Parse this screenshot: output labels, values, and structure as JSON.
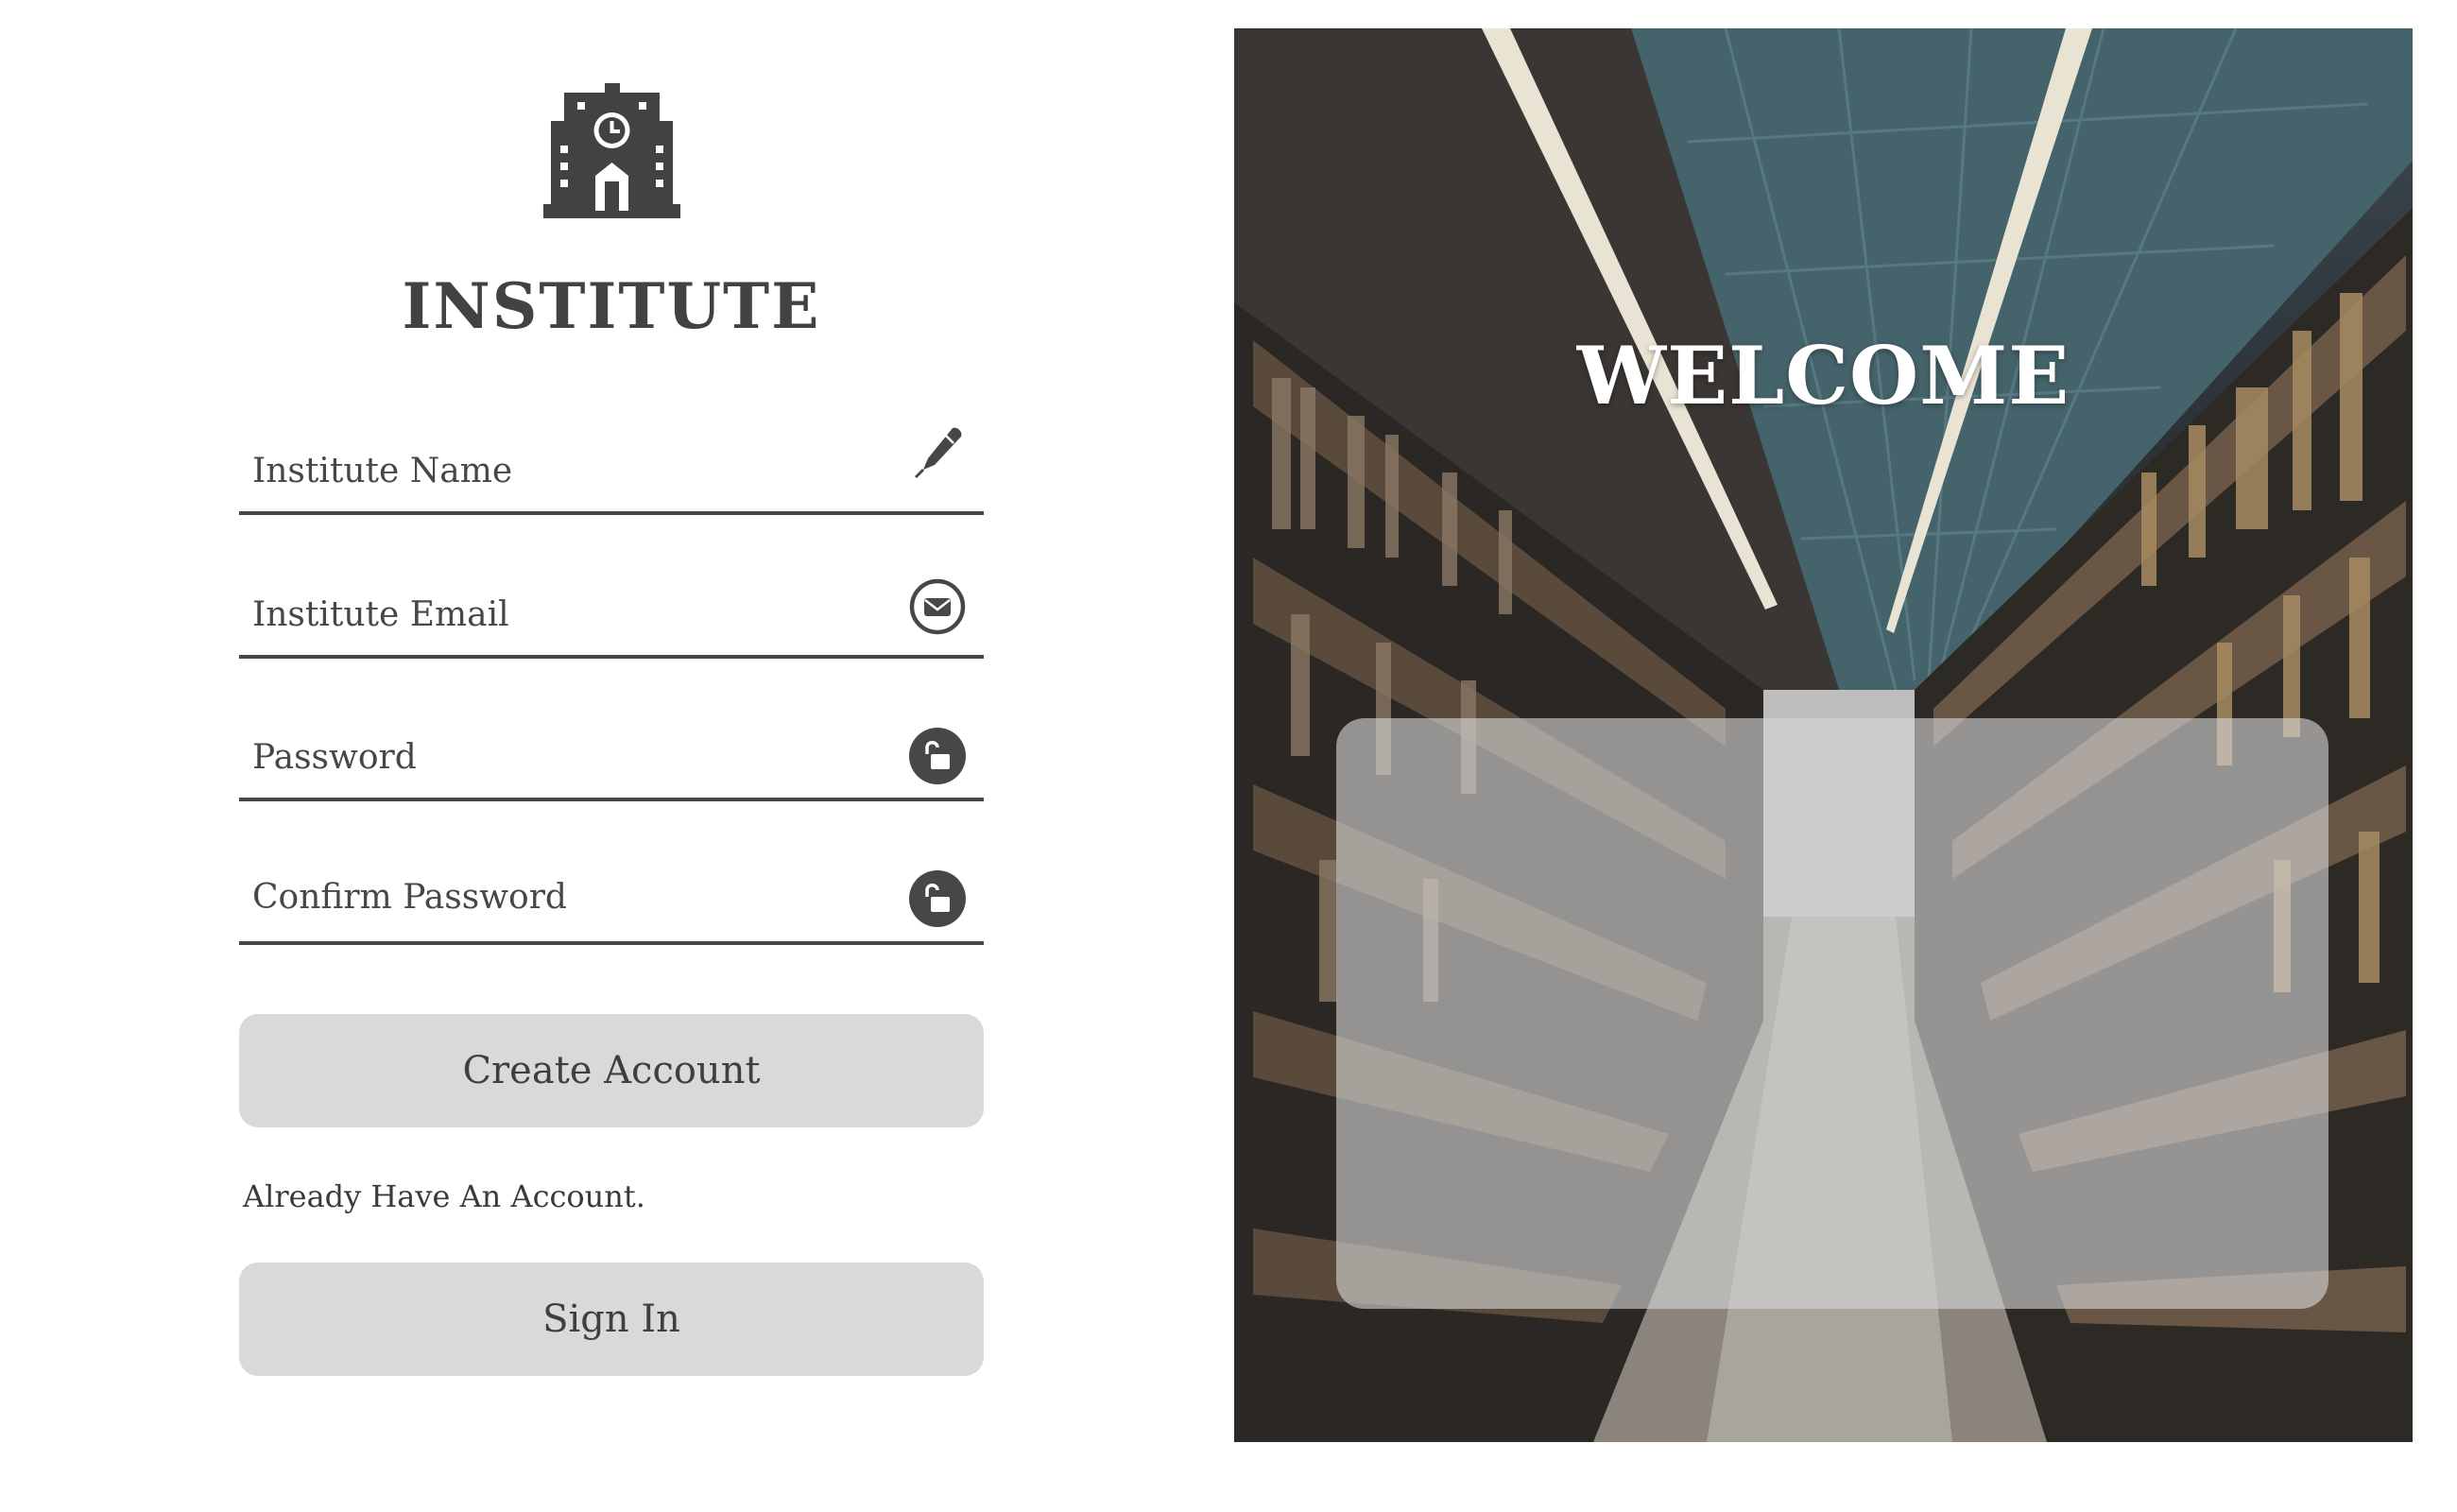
{
  "brand": {
    "logo_icon": "school-building-icon",
    "title": "INSTITUTE"
  },
  "form": {
    "fields": {
      "institute_name": {
        "placeholder": "Institute Name",
        "value": "",
        "icon": "pen-icon"
      },
      "institute_email": {
        "placeholder": "Institute Email",
        "value": "",
        "icon": "envelope-icon"
      },
      "password": {
        "placeholder": "Password",
        "value": "",
        "icon": "unlock-icon"
      },
      "confirm_password": {
        "placeholder": "Confirm Password",
        "value": "",
        "icon": "unlock-icon"
      }
    },
    "create_account_label": "Create Account",
    "already_have_account_text": "Already Have An Account.",
    "sign_in_label": "Sign In"
  },
  "hero": {
    "heading": "WELCOME",
    "background": "library-aisle-photo"
  },
  "colors": {
    "text": "#424242",
    "field_underline": "#474747",
    "button_bg": "#d9d9d9",
    "card_overlay": "rgba(215,215,215,0.62)",
    "heading_on_photo": "#ffffff"
  }
}
